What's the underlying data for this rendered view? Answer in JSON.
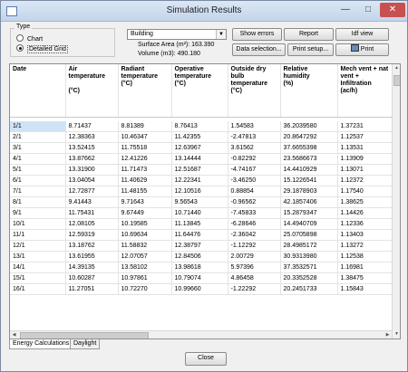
{
  "window": {
    "title": "Simulation Results"
  },
  "type_group": {
    "label": "Type",
    "options": [
      {
        "label": "Chart",
        "selected": false
      },
      {
        "label": "Detailed Grid",
        "selected": true
      }
    ]
  },
  "zone_select": {
    "value": "Building"
  },
  "surface_area": "Surface Area (m²): 163.390",
  "volume": "Volume (m3): 490.180",
  "buttons": {
    "show_errors": "Show errors",
    "report": "Report",
    "idf_view": "Idf view",
    "data_selection": "Data selection...",
    "print_setup": "Print setup...",
    "print": "Print",
    "close": "Close"
  },
  "tabs": [
    {
      "label": "Energy Calculations",
      "active": true
    },
    {
      "label": "Daylight",
      "active": false
    }
  ],
  "grid": {
    "columns": [
      "Date",
      "Air temperature\n\n(°C)",
      "Radiant temperature\n(°C)",
      "Operative temperature\n(°C)",
      "Outside dry bulb temperature\n(°C)",
      "Relative humidity\n(%)",
      "Mech vent + nat vent + Infiltration\n(ac/h)"
    ],
    "rows": [
      [
        "1/1",
        "8.71437",
        "8.81389",
        "8.76413",
        "1.54583",
        "36.2039580",
        "1.37231"
      ],
      [
        "2/1",
        "12.38363",
        "10.46347",
        "11.42355",
        "-2.47813",
        "20.8647292",
        "1.12537"
      ],
      [
        "3/1",
        "13.52415",
        "11.75518",
        "12.63967",
        "3.61562",
        "37.6655398",
        "1.13531"
      ],
      [
        "4/1",
        "13.87662",
        "12.41226",
        "13.14444",
        "-0.82292",
        "23.5686673",
        "1.13909"
      ],
      [
        "5/1",
        "13.31900",
        "11.71473",
        "12.51687",
        "-4.74167",
        "14.4410929",
        "1.13071"
      ],
      [
        "6/1",
        "13.04054",
        "11.40629",
        "12.22341",
        "-3.46250",
        "15.1226541",
        "1.12372"
      ],
      [
        "7/1",
        "12.72877",
        "11.48155",
        "12.10516",
        "0.88854",
        "29.1878903",
        "1.17540"
      ],
      [
        "8/1",
        "9.41443",
        "9.71643",
        "9.56543",
        "-0.96562",
        "42.1857406",
        "1.38625"
      ],
      [
        "9/1",
        "11.75431",
        "9.67449",
        "10.71440",
        "-7.45833",
        "15.2879347",
        "1.14426"
      ],
      [
        "10/1",
        "12.08105",
        "10.19585",
        "11.13845",
        "-6.28646",
        "14.4940709",
        "1.12336"
      ],
      [
        "11/1",
        "12.59319",
        "10.69634",
        "11.64476",
        "-2.36042",
        "25.0705898",
        "1.13403"
      ],
      [
        "12/1",
        "13.18762",
        "11.58832",
        "12.38797",
        "-1.12292",
        "28.4985172",
        "1.13272"
      ],
      [
        "13/1",
        "13.61955",
        "12.07057",
        "12.84506",
        "2.00729",
        "30.9313980",
        "1.12538"
      ],
      [
        "14/1",
        "14.39135",
        "13.58102",
        "13.98618",
        "5.97396",
        "37.3532571",
        "1.16981"
      ],
      [
        "15/1",
        "10.60287",
        "10.97861",
        "10.79074",
        "4.86458",
        "20.3352528",
        "1.38475"
      ],
      [
        "16/1",
        "11.27051",
        "10.72270",
        "10.99660",
        "-1.22292",
        "20.2451733",
        "1.15843"
      ]
    ]
  }
}
